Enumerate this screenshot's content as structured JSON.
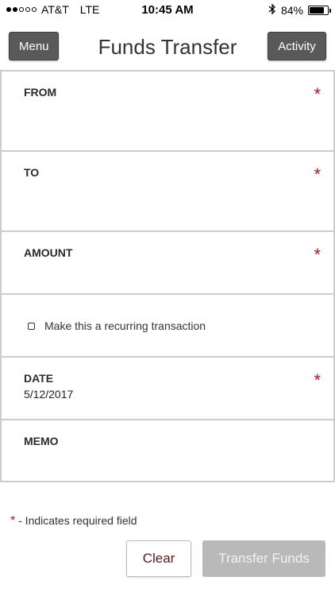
{
  "status_bar": {
    "carrier": "AT&T",
    "network": "LTE",
    "time": "10:45 AM",
    "battery_percent": "84%",
    "battery_level": 0.84,
    "signal_bars_on": 2,
    "signal_bars_total": 5
  },
  "header": {
    "menu_label": "Menu",
    "title": "Funds Transfer",
    "activity_label": "Activity"
  },
  "form": {
    "from": {
      "label": "FROM",
      "required": "*"
    },
    "to": {
      "label": "TO",
      "required": "*"
    },
    "amount": {
      "label": "AMOUNT",
      "required": "*"
    },
    "recurring": {
      "label": "Make this a recurring transaction"
    },
    "date": {
      "label": "DATE",
      "value": "5/12/2017",
      "required": "*"
    },
    "memo": {
      "label": "MEMO"
    }
  },
  "footer": {
    "required_star": "*",
    "required_note": " - Indicates required field",
    "clear_label": "Clear",
    "transfer_label": "Transfer Funds"
  },
  "colors": {
    "accent_required": "#a01e24",
    "header_button": "#595959",
    "disabled_button": "#b9b9b9"
  }
}
